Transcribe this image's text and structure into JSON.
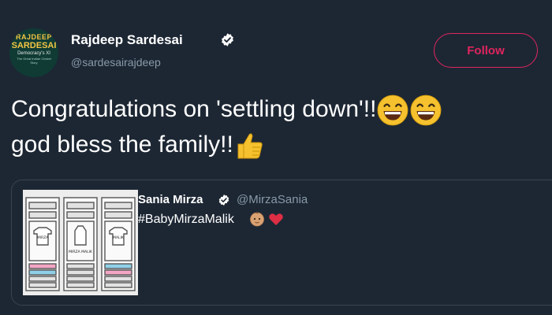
{
  "tweet": {
    "author_name": "Rajdeep Sardesai",
    "handle": "@sardesairajdeep",
    "avatar_text": {
      "line1": "RAJDEEP",
      "line2": "SARDESAI",
      "line3": "Democracy's XI",
      "line4": "The Great Indian Cricket Story",
      "line5": ""
    },
    "follow_label": "Follow",
    "text_line1": "Congratulations on 'settling down'!!",
    "text_line2": "god bless the family!!"
  },
  "quoted_tweet": {
    "author_name": "Sania Mirza",
    "handle": "@MirzaSania",
    "text": "#BabyMirzaMalik",
    "media_labels": [
      "MIRZA",
      "MIRZA MALIK",
      "MALIK"
    ]
  },
  "icons": {
    "verified": "verified-badge-icon",
    "grin": "grinning-face-emoji",
    "thumbs_up": "thumbs-up-emoji",
    "baby": "baby-emoji",
    "heart": "red-heart-emoji"
  },
  "colors": {
    "background": "#1d2734",
    "follow_accent": "#e0245e",
    "secondary_text": "#8899a6",
    "card_border": "#38444d",
    "verified": "#ffffff"
  }
}
